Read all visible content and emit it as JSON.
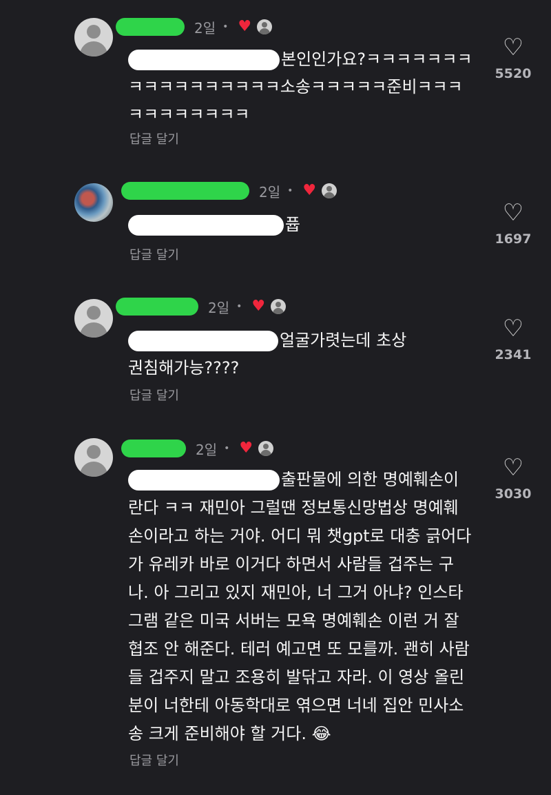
{
  "comments": [
    {
      "time": "2일",
      "dot": "•",
      "text": "본인인가요?ㅋㅋㅋㅋㅋㅋㅋㅋㅋㅋㅋㅋㅋㅋㅋㅋㅋ소송ㅋㅋㅋㅋㅋ준비ㅋㅋㅋㅋㅋㅋㅋㅋㅋㅋㅋ",
      "reply_label": "답글 달기",
      "likes": "5520"
    },
    {
      "time": "2일",
      "dot": "•",
      "text": "퓹",
      "reply_label": "답글 달기",
      "likes": "1697"
    },
    {
      "time": "2일",
      "dot": "•",
      "text": "얼굴가렷는데 초상권침해가능????",
      "reply_label": "답글 달기",
      "likes": "2341"
    },
    {
      "time": "2일",
      "dot": "•",
      "text": "출판물에 의한 명예훼손이란다 ㅋㅋ 재민아 그럴땐 정보통신망법상 명예훼손이라고 하는 거야. 어디 뭐 챗gpt로 대충 긁어다가 유레카 바로 이거다 하면서 사람들 겁주는 구나. 아 그리고 있지 재민아, 너 그거 아냐? 인스타그램 같은 미국 서버는 모욕 명예훼손 이런 거 잘 협조 안 해준다. 테러 예고면 또 모를까. 괜히 사람들 겁주지 말고 조용히 발닦고 자라. 이 영상 올린 분이 너한테 아동학대로 엮으면 너네 집안 민사소송 크게 준비해야 할 거다. 😂",
      "reply_label": "답글 달기",
      "likes": "3030"
    }
  ],
  "icons": {
    "creator_heart": "heart-filled-icon",
    "like": "heart-outline-icon",
    "avatar": "default-avatar-icon"
  },
  "colors": {
    "background": "#1e1e22",
    "username_redaction": "#2fd44a",
    "mention_redaction": "#ffffff",
    "creator_heart": "#f0263c"
  }
}
